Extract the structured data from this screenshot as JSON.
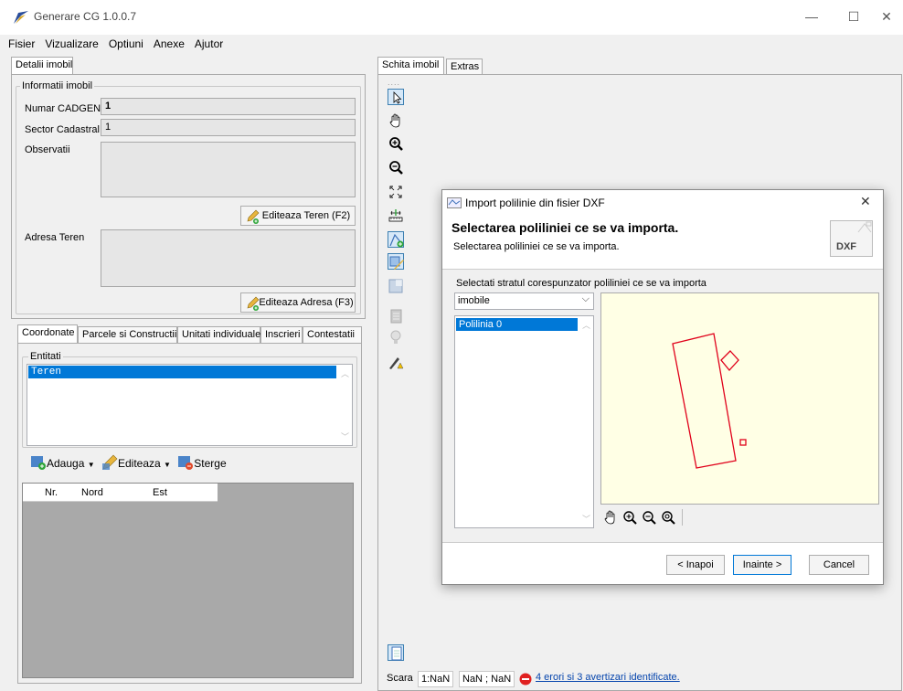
{
  "window": {
    "title": "Generare CG 1.0.0.7",
    "minimize": "—",
    "maximize": "☐",
    "close": "✕"
  },
  "menu": {
    "items": [
      "Fisier",
      "Vizualizare",
      "Optiuni",
      "Anexe",
      "Ajutor"
    ]
  },
  "left": {
    "main_tab": "Detalii imobil",
    "info": {
      "group_title": "Informatii imobil",
      "numar_label": "Numar CADGEN",
      "numar_value": "1",
      "sector_label": "Sector Cadastral",
      "sector_value": "1",
      "obs_label": "Observatii",
      "edit_teren_btn": "Editeaza Teren (F2)",
      "adresa_label": "Adresa Teren",
      "edit_adresa_btn": "Editeaza Adresa (F3)"
    },
    "tabs": [
      "Coordonate",
      "Parcele si Constructii",
      "Unitati individuale",
      "Inscrieri",
      "Contestatii"
    ],
    "entitati": {
      "title": "Entitati",
      "items": [
        "Teren"
      ]
    },
    "actions": {
      "add": "Adauga",
      "edit": "Editeaza",
      "delete": "Sterge"
    },
    "grid": {
      "columns": [
        "Nr.",
        "Nord",
        "Est"
      ]
    }
  },
  "right": {
    "tabs": [
      "Schita imobil",
      "Extras"
    ]
  },
  "dialog": {
    "title": "Import polilinie din fisier DXF",
    "close": "✕",
    "heading": "Selectarea poliliniei ce se va importa.",
    "subheading": "Selectarea poliliniei ce se va importa.",
    "badge": "DXF",
    "layer_label": "Selectati stratul corespunzator poliliniei ce se va importa",
    "layer_value": "imobile",
    "polylines": [
      "Polilinia 0"
    ],
    "buttons": {
      "back": "< Inapoi",
      "next": "Inainte >",
      "cancel": "Cancel"
    }
  },
  "status": {
    "scale_label": "Scara",
    "scale_value": "1:NaN",
    "coords": "NaN ; NaN",
    "errors_link": "4 erori si 3 avertizari identificate."
  },
  "colors": {
    "accent": "#0078d7",
    "preview_bg": "#ffffe5",
    "polyline": "#e0001a",
    "grid_bg": "#a9a9a9"
  },
  "icons": {
    "toolbar": [
      "pointer-icon",
      "pan-hand-icon",
      "zoom-in-icon",
      "zoom-out-icon",
      "zoom-extent-icon",
      "measure-icon",
      "draw-polyline-icon",
      "edit-polyline-icon",
      "layer-icon",
      "layer-disabled-icon",
      "bulb-icon",
      "warning-wand-icon",
      "page-icon"
    ],
    "preview_tools": [
      "pan-hand-icon",
      "zoom-in-icon",
      "zoom-out-icon",
      "zoom-extent-icon"
    ]
  }
}
